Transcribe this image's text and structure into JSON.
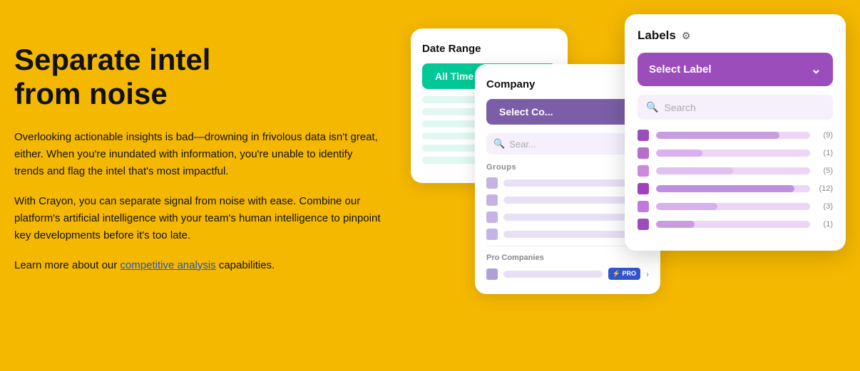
{
  "page": {
    "background_color": "#F5B800"
  },
  "left": {
    "headline_line1": "Separate intel",
    "headline_line2": "from noise",
    "body1": "Overlooking actionable insights is bad—drowning in frivolous data isn't great, either. When you're inundated with information, you're unable to identify trends and flag the intel that's most impactful.",
    "body2": "With Crayon, you can separate signal from noise with ease. Combine our platform's artificial intelligence with your team's human intelligence to pinpoint key developments before it's too late.",
    "body3_prefix": "Learn more about our ",
    "body3_link": "competitive analysis",
    "body3_suffix": " capabilities."
  },
  "date_range_card": {
    "title": "Date Range",
    "button_label": "All Time"
  },
  "company_card": {
    "title": "Company",
    "select_button": "Select Co...",
    "search_placeholder": "Sear...",
    "groups_label": "Groups",
    "pro_label": "Pro Companies",
    "pro_badge": "⚡ PRO"
  },
  "labels_card": {
    "title": "Labels",
    "gear": "⚙",
    "select_label": "Select Label",
    "chevron": "⌄",
    "search_placeholder": "Search",
    "items": [
      {
        "color": "#9B4DBB",
        "width_pct": 80,
        "count": "(9)"
      },
      {
        "color": "#B86FCC",
        "width_pct": 30,
        "count": "(1)"
      },
      {
        "color": "#CC88DD",
        "width_pct": 50,
        "count": "(5)"
      },
      {
        "color": "#A040C0",
        "width_pct": 90,
        "count": "(12)"
      },
      {
        "color": "#C07ADD",
        "width_pct": 40,
        "count": "(3)"
      },
      {
        "color": "#9B4DBB",
        "width_pct": 25,
        "count": "(1)"
      }
    ]
  }
}
